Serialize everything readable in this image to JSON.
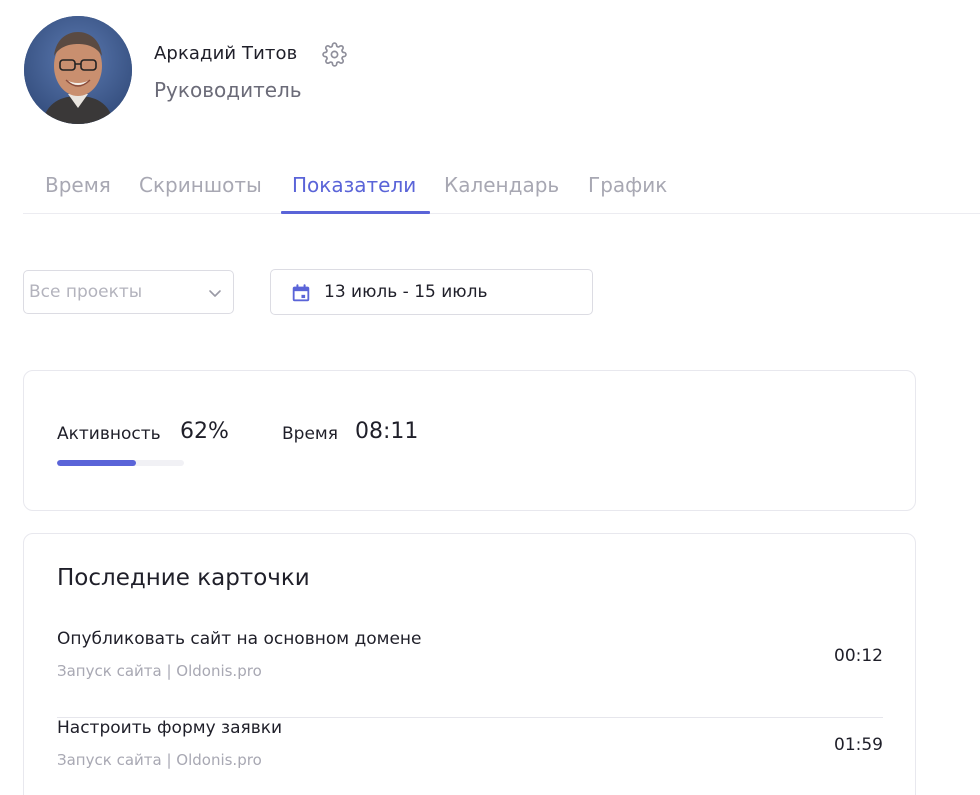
{
  "profile": {
    "name": "Аркадий Титов",
    "role": "Руководитель"
  },
  "tabs": [
    {
      "label": "Время",
      "active": false
    },
    {
      "label": "Скриншоты",
      "active": false
    },
    {
      "label": "Показатели",
      "active": true
    },
    {
      "label": "Календарь",
      "active": false
    },
    {
      "label": "График",
      "active": false
    }
  ],
  "filters": {
    "project_select": "Все проекты",
    "date_range": "13 июль - 15 июль"
  },
  "stats": {
    "activity_label": "Активность",
    "activity_value": "62%",
    "activity_fraction": 0.62,
    "time_label": "Время",
    "time_value": "08:11"
  },
  "recent": {
    "title": "Последние карточки",
    "items": [
      {
        "title": "Опубликовать сайт на основном домене",
        "subtitle": "Запуск сайта | Oldonis.pro",
        "time": "00:12"
      },
      {
        "title": "Настроить форму заявки",
        "subtitle": "Запуск сайта | Oldonis.pro",
        "time": "01:59"
      }
    ]
  },
  "icons": {
    "settings": "gear-icon",
    "dropdown": "chevron-down-icon",
    "date": "calendar-icon"
  },
  "colors": {
    "accent": "#5a64d8",
    "muted_text": "#a8a8b3",
    "text": "#1f1f29"
  }
}
